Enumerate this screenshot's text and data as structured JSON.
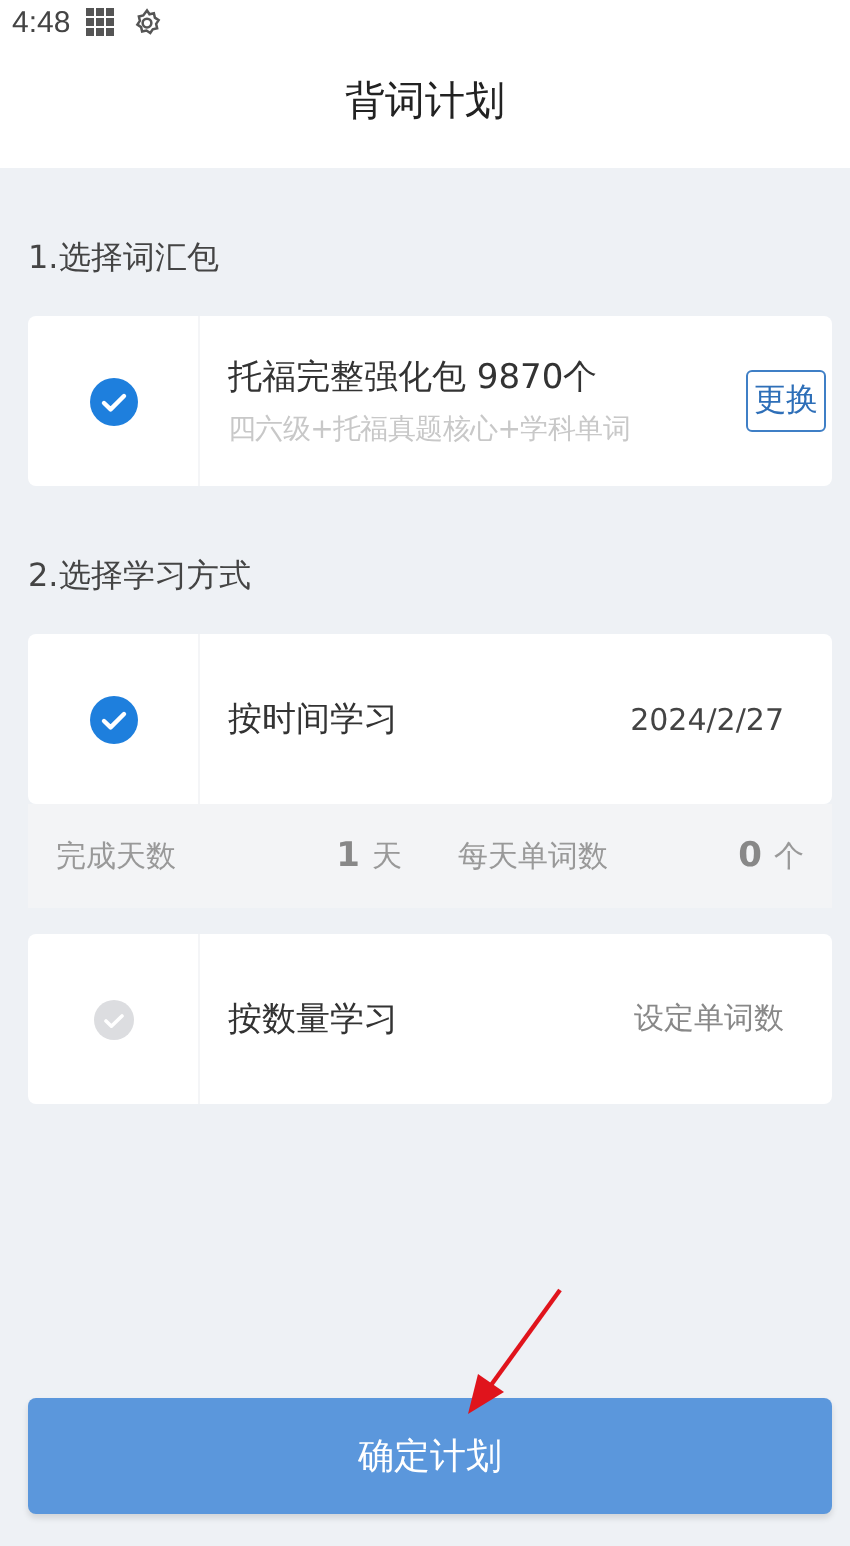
{
  "status_bar": {
    "time": "4:48"
  },
  "title": "背词计划",
  "package_section": {
    "label": "1.选择词汇包",
    "package": {
      "selected": true,
      "name": "托福完整强化包 9870个",
      "description": "四六级+托福真题核心+学科单词",
      "change_button": "更换"
    }
  },
  "method_section": {
    "label": "2.选择学习方式",
    "methods": [
      {
        "kind": "time",
        "selected": true,
        "label": "按时间学习",
        "value": "2024/2/27",
        "stats": [
          {
            "label": "完成天数",
            "number": "1",
            "unit": "天"
          },
          {
            "label": "每天单词数",
            "number": "0",
            "unit": "个"
          }
        ]
      },
      {
        "kind": "count",
        "selected": false,
        "label": "按数量学习",
        "value": "设定单词数"
      }
    ]
  },
  "confirm_button": "确定计划"
}
